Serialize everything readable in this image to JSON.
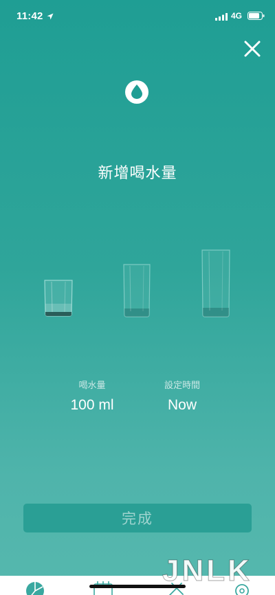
{
  "status_bar": {
    "time": "11:42",
    "network": "4G",
    "icons": [
      "location-arrow-icon",
      "signal-icon",
      "battery-icon"
    ]
  },
  "header": {
    "close_icon": "close-icon",
    "drop_icon": "water-drop-icon",
    "title": "新增喝水量"
  },
  "glasses": [
    {
      "name": "small-glass",
      "level": "small"
    },
    {
      "name": "medium-glass",
      "level": "medium"
    },
    {
      "name": "large-glass",
      "level": "large"
    }
  ],
  "info": {
    "amount_label": "喝水量",
    "amount_value": "100 ml",
    "time_label": "設定時間",
    "time_value": "Now"
  },
  "done_button": {
    "label": "完成"
  },
  "watermark": "JNLK",
  "tab_bar": {
    "icons": [
      "pie-chart-icon",
      "calendar-icon",
      "tools-icon",
      "settings-icon"
    ]
  },
  "colors": {
    "accent": "#1f9e94",
    "button_bg": "#2a9f95",
    "tab_icon": "#3aa8a0"
  }
}
